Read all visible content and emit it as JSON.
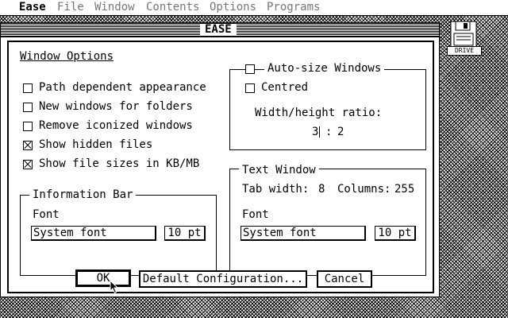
{
  "menubar": {
    "items": [
      {
        "label": "Ease",
        "active": true
      },
      {
        "label": "File",
        "active": false
      },
      {
        "label": "Window",
        "active": false
      },
      {
        "label": "Contents",
        "active": false
      },
      {
        "label": "Options",
        "active": false
      },
      {
        "label": "Programs",
        "active": false
      }
    ]
  },
  "desktop": {
    "drive_label": "DRIVE"
  },
  "window": {
    "title": "EASE"
  },
  "dialog": {
    "heading": "Window Options",
    "checkboxes": [
      {
        "label": "Path dependent appearance",
        "checked": false
      },
      {
        "label": "New windows for folders",
        "checked": false
      },
      {
        "label": "Remove iconized windows",
        "checked": false
      },
      {
        "label": "Show hidden files",
        "checked": true
      },
      {
        "label": "Show file sizes in KB/MB",
        "checked": true
      }
    ],
    "size_group": {
      "autosize_label": "Auto-size Windows",
      "autosize_checked": false,
      "centred_label": "Centred",
      "centred_checked": false,
      "ratio_label": "Width/height ratio:",
      "ratio_w": "3",
      "ratio_sep": ":",
      "ratio_h": "2"
    },
    "info_bar": {
      "title": "Information Bar",
      "font_label": "Font",
      "font_value": "System font",
      "size_value": "10 pt"
    },
    "text_window": {
      "title": "Text Window",
      "tab_label": "Tab width:",
      "tab_value": "8",
      "columns_label": "Columns:",
      "columns_value": "255",
      "font_label": "Font",
      "font_value": "System font",
      "size_value": "10 pt"
    },
    "buttons": {
      "ok": "OK",
      "default_config": "Default Configuration...",
      "cancel": "Cancel"
    }
  }
}
